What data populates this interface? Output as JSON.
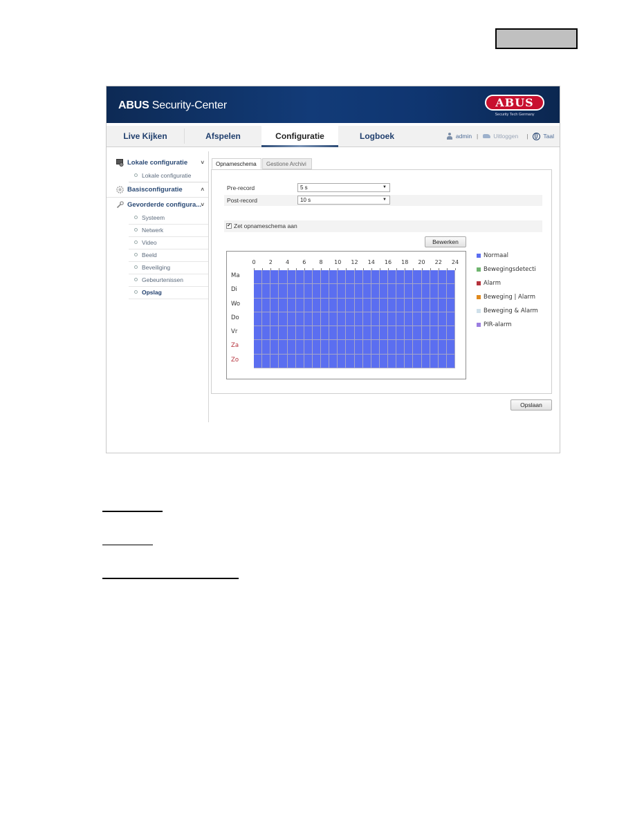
{
  "page_label_box": "",
  "app": {
    "brand": "ABUS",
    "title_suffix": " Security-Center",
    "logo_text": "ABUS",
    "logo_tagline": "Security Tech Germany"
  },
  "nav": {
    "tabs": [
      {
        "label": "Live Kijken",
        "active": false
      },
      {
        "label": "Afspelen",
        "active": false
      },
      {
        "label": "Configuratie",
        "active": true
      },
      {
        "label": "Logboek",
        "active": false
      }
    ],
    "user": "admin",
    "logout": "Uitloggen",
    "language": "Taal",
    "separator": "|"
  },
  "sidebar": {
    "groups": [
      {
        "label": "Lokale configuratie",
        "chevron": "˅",
        "icon": "monitor-gear-icon",
        "items": [
          {
            "label": "Lokale configuratie",
            "active": false
          }
        ]
      },
      {
        "label": "Basisconfiguratie",
        "chevron": "˄",
        "icon": "gear-icon",
        "items": []
      },
      {
        "label": "Gevorderde configura...",
        "chevron": "˅",
        "icon": "wrench-icon",
        "items": [
          {
            "label": "Systeem",
            "active": false
          },
          {
            "label": "Netwerk",
            "active": false
          },
          {
            "label": "Video",
            "active": false
          },
          {
            "label": "Beeld",
            "active": false
          },
          {
            "label": "Beveiliging",
            "active": false
          },
          {
            "label": "Gebeurtenissen",
            "active": false
          },
          {
            "label": "Opslag",
            "active": true
          }
        ]
      }
    ]
  },
  "content": {
    "tabs": [
      {
        "label": "Opnameschema",
        "active": true
      },
      {
        "label": "Gestione Archivi",
        "active": false
      }
    ],
    "pre_record": {
      "label": "Pre-record",
      "value": "5 s"
    },
    "post_record": {
      "label": "Post-record",
      "value": "10 s"
    },
    "enable_schedule": {
      "label": "Zet opnameschema aan",
      "checked": true
    },
    "edit_button": "Bewerken",
    "save_button": "Opslaan",
    "dropdown_arrow": "▼",
    "check_mark": "✔"
  },
  "schedule": {
    "hour_labels": [
      "0",
      "2",
      "4",
      "6",
      "8",
      "10",
      "12",
      "14",
      "16",
      "18",
      "20",
      "22",
      "24"
    ],
    "days": [
      {
        "label": "Ma",
        "weekend": false
      },
      {
        "label": "Di",
        "weekend": false
      },
      {
        "label": "Wo",
        "weekend": false
      },
      {
        "label": "Do",
        "weekend": false
      },
      {
        "label": "Vr",
        "weekend": false
      },
      {
        "label": "Za",
        "weekend": true
      },
      {
        "label": "Zo",
        "weekend": true
      }
    ],
    "hours_per_day": 24,
    "filled_mode": "Normaal",
    "coverage_percent": 100
  },
  "legend": [
    {
      "label": "Normaal",
      "color": "#5b6ef0"
    },
    {
      "label": "Bewegingsdetecti",
      "color": "#6fb56f"
    },
    {
      "label": "Alarm",
      "color": "#b5323c"
    },
    {
      "label": "Beweging | Alarm",
      "color": "#e08a1e"
    },
    {
      "label": "Beweging & Alarm",
      "color": "#cfe0ea"
    },
    {
      "label": "PIR-alarm",
      "color": "#9b7ee0"
    }
  ]
}
